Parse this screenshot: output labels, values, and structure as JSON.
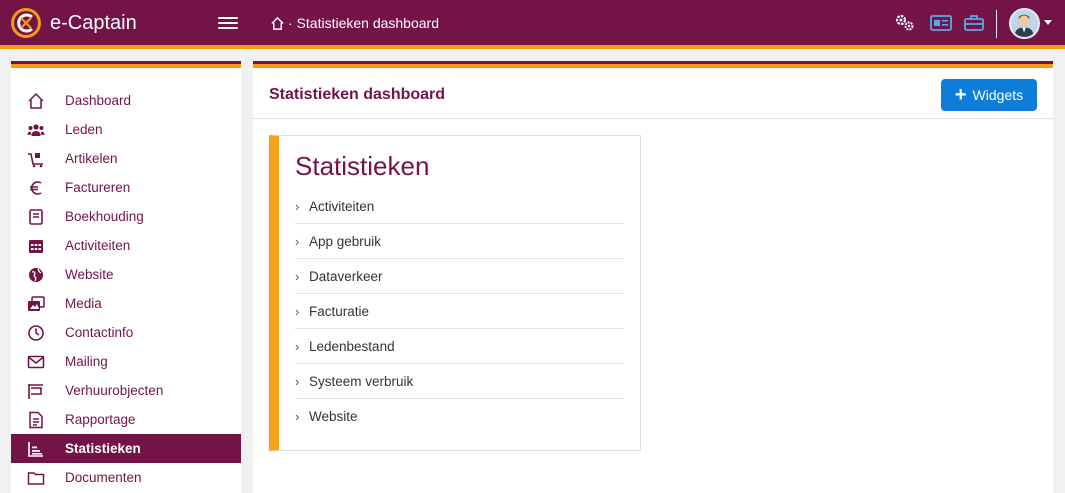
{
  "app": {
    "brand": "e-Captain"
  },
  "header": {
    "breadcrumb": "· Statistieken dashboard"
  },
  "sidebar": {
    "items": [
      {
        "label": "Dashboard",
        "icon": "home-icon"
      },
      {
        "label": "Leden",
        "icon": "users-icon"
      },
      {
        "label": "Artikelen",
        "icon": "cart-icon"
      },
      {
        "label": "Factureren",
        "icon": "euro-icon"
      },
      {
        "label": "Boekhouding",
        "icon": "book-icon"
      },
      {
        "label": "Activiteiten",
        "icon": "calendar-icon"
      },
      {
        "label": "Website",
        "icon": "globe-icon"
      },
      {
        "label": "Media",
        "icon": "images-icon"
      },
      {
        "label": "Contactinfo",
        "icon": "clock-icon"
      },
      {
        "label": "Mailing",
        "icon": "envelope-icon"
      },
      {
        "label": "Verhuurobjecten",
        "icon": "sign-icon"
      },
      {
        "label": "Rapportage",
        "icon": "report-icon"
      },
      {
        "label": "Statistieken",
        "icon": "chart-icon",
        "active": true
      },
      {
        "label": "Documenten",
        "icon": "folder-icon"
      }
    ]
  },
  "main": {
    "title": "Statistieken dashboard",
    "widgets_label": "Widgets",
    "card": {
      "title": "Statistieken",
      "items": [
        "Activiteiten",
        "App gebruik",
        "Dataverkeer",
        "Facturatie",
        "Ledenbestand",
        "Systeem verbruik",
        "Website"
      ]
    }
  },
  "colors": {
    "primary": "#741346",
    "accent": "#f39c12",
    "button": "#0d7dd9"
  }
}
